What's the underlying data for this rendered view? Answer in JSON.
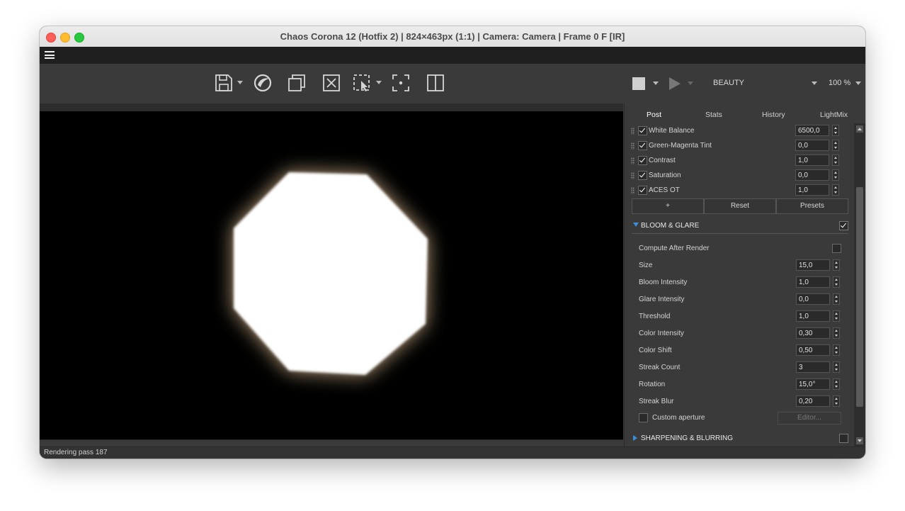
{
  "window": {
    "title": "Chaos Corona 12 (Hotfix 2) | 824×463px (1:1) | Camera: Camera | Frame 0 F [IR]"
  },
  "toolbar": {
    "icons": [
      "save-icon",
      "corona-logo-icon",
      "copy-icon",
      "clear-icon",
      "region-select-icon",
      "focus-point-icon",
      "split-view-icon"
    ],
    "render_pass": "BEAUTY",
    "zoom": "100 %"
  },
  "panel": {
    "tabs": [
      "Post",
      "Stats",
      "History",
      "LightMix"
    ],
    "active_tab": "Post",
    "post_ops": [
      {
        "label": "White Balance",
        "checked": true,
        "value": "6500,0"
      },
      {
        "label": "Green-Magenta Tint",
        "checked": true,
        "value": "0,0"
      },
      {
        "label": "Contrast",
        "checked": true,
        "value": "1,0"
      },
      {
        "label": "Saturation",
        "checked": true,
        "value": "0,0"
      },
      {
        "label": "ACES OT",
        "checked": true,
        "value": "1,0"
      }
    ],
    "buttons": {
      "add": "+",
      "reset": "Reset",
      "presets": "Presets"
    },
    "bloom": {
      "title": "BLOOM & GLARE",
      "enabled": true,
      "compute_after_render": "Compute After Render",
      "params": [
        {
          "label": "Size",
          "value": "15,0"
        },
        {
          "label": "Bloom Intensity",
          "value": "1,0"
        },
        {
          "label": "Glare Intensity",
          "value": "0,0"
        },
        {
          "label": "Threshold",
          "value": "1,0"
        },
        {
          "label": "Color Intensity",
          "value": "0,30"
        },
        {
          "label": "Color Shift",
          "value": "0,50"
        },
        {
          "label": "Streak Count",
          "value": "3"
        },
        {
          "label": "Rotation",
          "value": "15,0°"
        },
        {
          "label": "Streak Blur",
          "value": "0,20"
        }
      ],
      "custom_aperture": "Custom aperture",
      "editor": "Editor..."
    },
    "sharpening": {
      "title": "SHARPENING & BLURRING",
      "enabled": false
    }
  },
  "status": {
    "text": "Rendering pass 187"
  }
}
